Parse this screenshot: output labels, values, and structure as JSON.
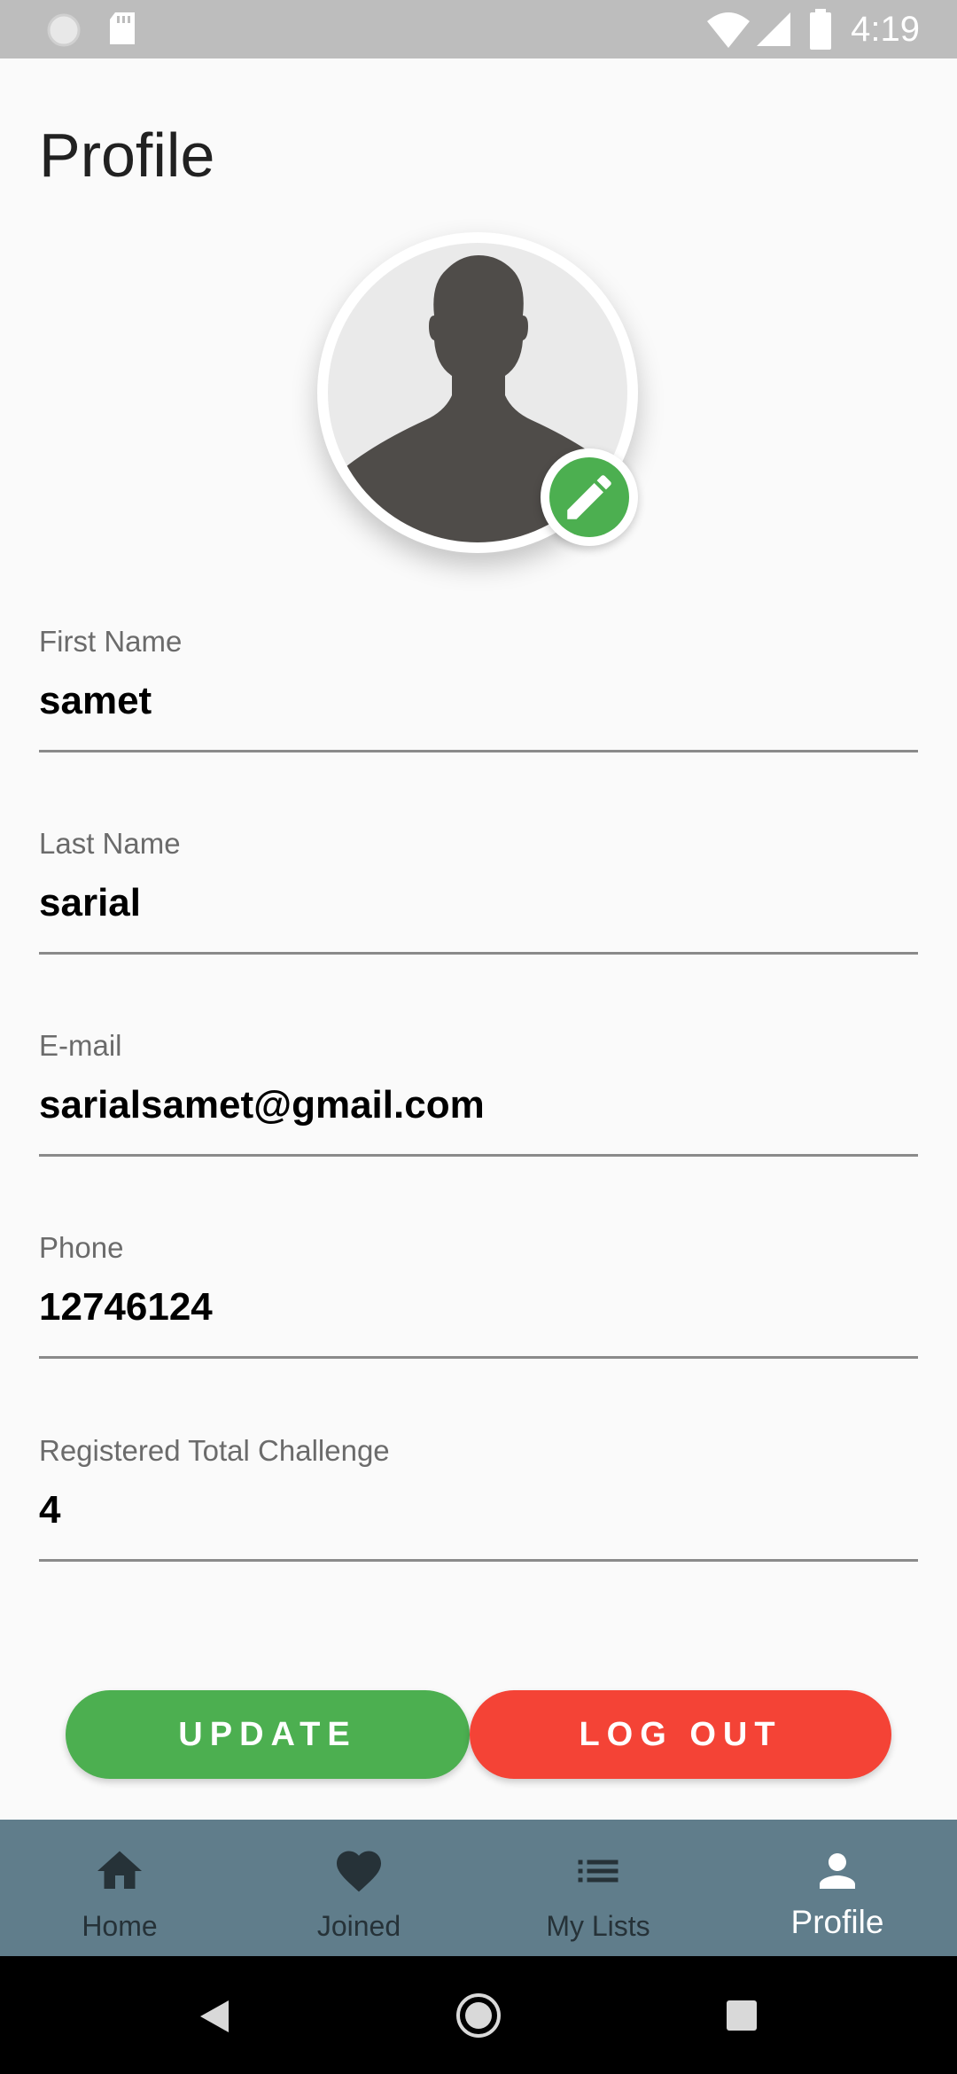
{
  "status_bar": {
    "time": "4:19",
    "icons": [
      "sync-icon",
      "sd-card-icon",
      "wifi-icon",
      "signal-icon",
      "battery-icon"
    ]
  },
  "page": {
    "title": "Profile"
  },
  "avatar": {
    "icon": "person-silhouette-icon",
    "edit_icon": "pencil-icon",
    "edit_color": "#4CAF50"
  },
  "fields": [
    {
      "label": "First Name",
      "value": "samet"
    },
    {
      "label": "Last Name",
      "value": "sarial"
    },
    {
      "label": "E-mail",
      "value": "sarialsamet@gmail.com"
    },
    {
      "label": "Phone",
      "value": "12746124"
    },
    {
      "label": "Registered Total Challenge",
      "value": "4"
    }
  ],
  "buttons": {
    "update_label": "UPDATE",
    "logout_label": "LOG OUT",
    "update_color": "#4CAF50",
    "logout_color": "#F44336"
  },
  "bottom_nav": {
    "background": "#607D8B",
    "items": [
      {
        "label": "Home",
        "icon": "home-icon",
        "active": false
      },
      {
        "label": "Joined",
        "icon": "heart-icon",
        "active": false
      },
      {
        "label": "My Lists",
        "icon": "list-icon",
        "active": false
      },
      {
        "label": "Profile",
        "icon": "person-icon",
        "active": true
      }
    ]
  },
  "system_nav": {
    "icons": [
      "back-icon",
      "home-circle-icon",
      "recents-icon"
    ]
  }
}
